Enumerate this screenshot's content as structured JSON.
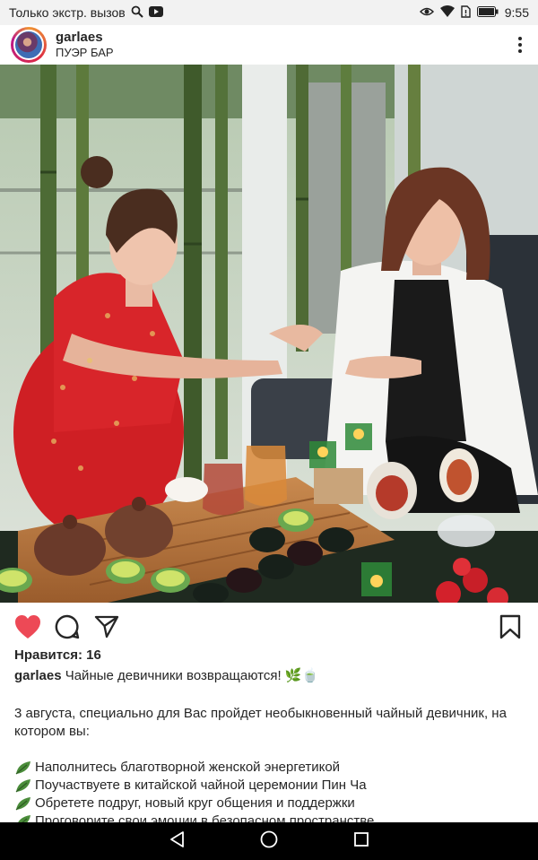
{
  "status_bar": {
    "left_text": "Только экстр. вызов",
    "time": "9:55",
    "icons": [
      "search-icon",
      "youtube-icon",
      "eye-icon",
      "wifi-icon",
      "sim-icon",
      "battery-icon"
    ]
  },
  "post": {
    "username": "garlaes",
    "location": "ПУЭР БАР",
    "likes": "Нравится: 16",
    "caption_user": "garlaes",
    "caption_text": "Чайные девичники возвращаются!",
    "caption_emoji": "🌿🍵",
    "paragraph": "3 августа, специально для Вас пройдет необыкновенный чайный девичник, на котором вы:",
    "bullets": [
      "Наполнитесь благотворной женской энергетикой",
      "Поучаствуете в китайской чайной церемонии Пин Ча",
      "Обретете подруг, новый круг общения и поддержки",
      "Проговорите свои эмоции в безопасном пространстве"
    ]
  },
  "colors": {
    "like_red": "#ed4956",
    "leaf_green": "#4a8c3a",
    "nav_bg": "#000000"
  }
}
